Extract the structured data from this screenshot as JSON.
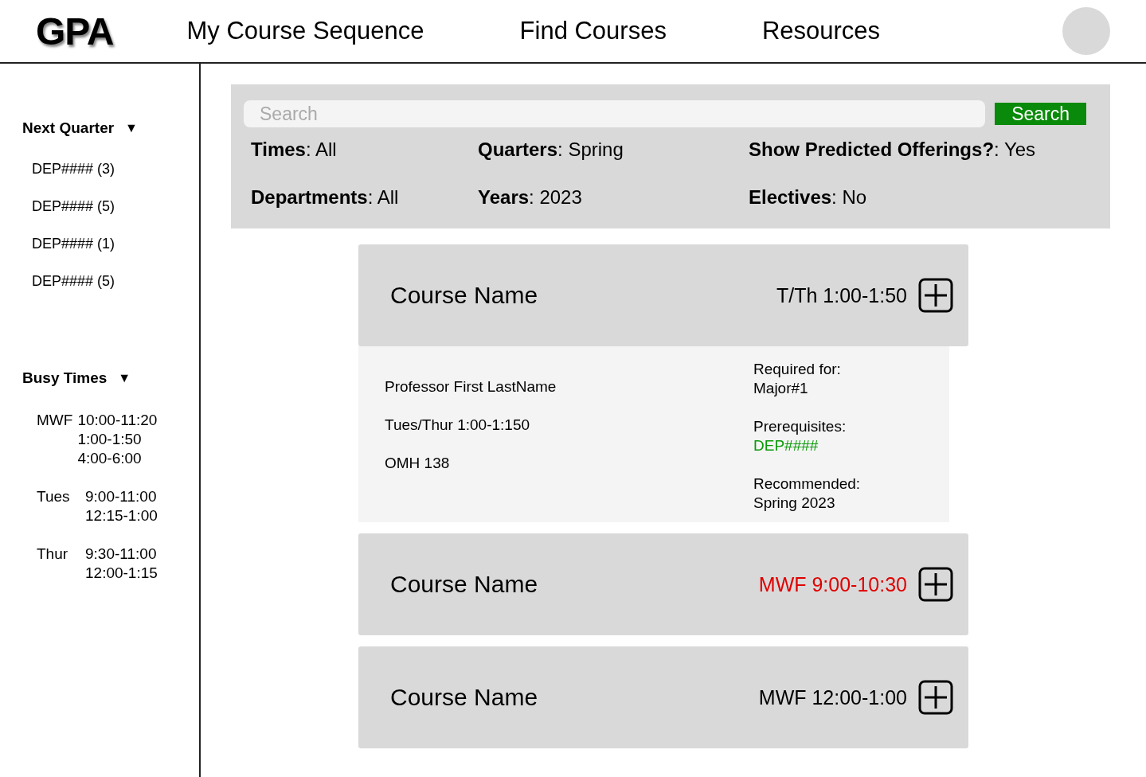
{
  "logo": "GPA",
  "nav": [
    {
      "label": "My Course Sequence"
    },
    {
      "label": "Find Courses"
    },
    {
      "label": "Resources"
    }
  ],
  "sidebar": {
    "sections": [
      {
        "title": "Next Quarter",
        "toggle": "▼",
        "items": [
          "DEP#### (3)",
          "DEP#### (5)",
          "DEP#### (1)",
          "DEP#### (5)"
        ]
      },
      {
        "title": "Busy Times",
        "toggle": "▼",
        "groups": [
          {
            "day": "MWF",
            "times": [
              "10:00-11:20",
              "1:00-1:50",
              "4:00-6:00"
            ]
          },
          {
            "day": "Tues",
            "times": [
              "9:00-11:00",
              "12:15-1:00"
            ]
          },
          {
            "day": "Thur",
            "times": [
              "9:30-11:00",
              "12:00-1:15"
            ]
          }
        ]
      }
    ]
  },
  "search": {
    "placeholder": "Search",
    "button": "Search"
  },
  "filters": [
    "**Times**: All",
    "**Quarters**: Spring",
    "**Show Predicted Offerings?**: Yes",
    "**Departments**: All",
    "**Years**: 2023",
    "**Electives**: No"
  ],
  "courses": [
    {
      "name": "Course Name",
      "time": "T/Th 1:00-1:50",
      "conflict": false,
      "details": {
        "info": [
          "Professor First LastName",
          "Tues/Thur 1:00-1:150",
          "OMH 138"
        ],
        "sections": [
          {
            "label": "Required for:",
            "value": "Major#1",
            "kind": "plain"
          },
          {
            "label": "Prerequisites:",
            "value": "DEP####",
            "kind": "link"
          },
          {
            "label": "Recommended:",
            "value": "Spring 2023",
            "kind": "plain"
          }
        ]
      }
    },
    {
      "name": "Course Name",
      "time": "MWF 9:00-10:30",
      "conflict": true
    },
    {
      "name": "Course Name",
      "time": "MWF 12:00-1:00",
      "conflict": false
    }
  ]
}
